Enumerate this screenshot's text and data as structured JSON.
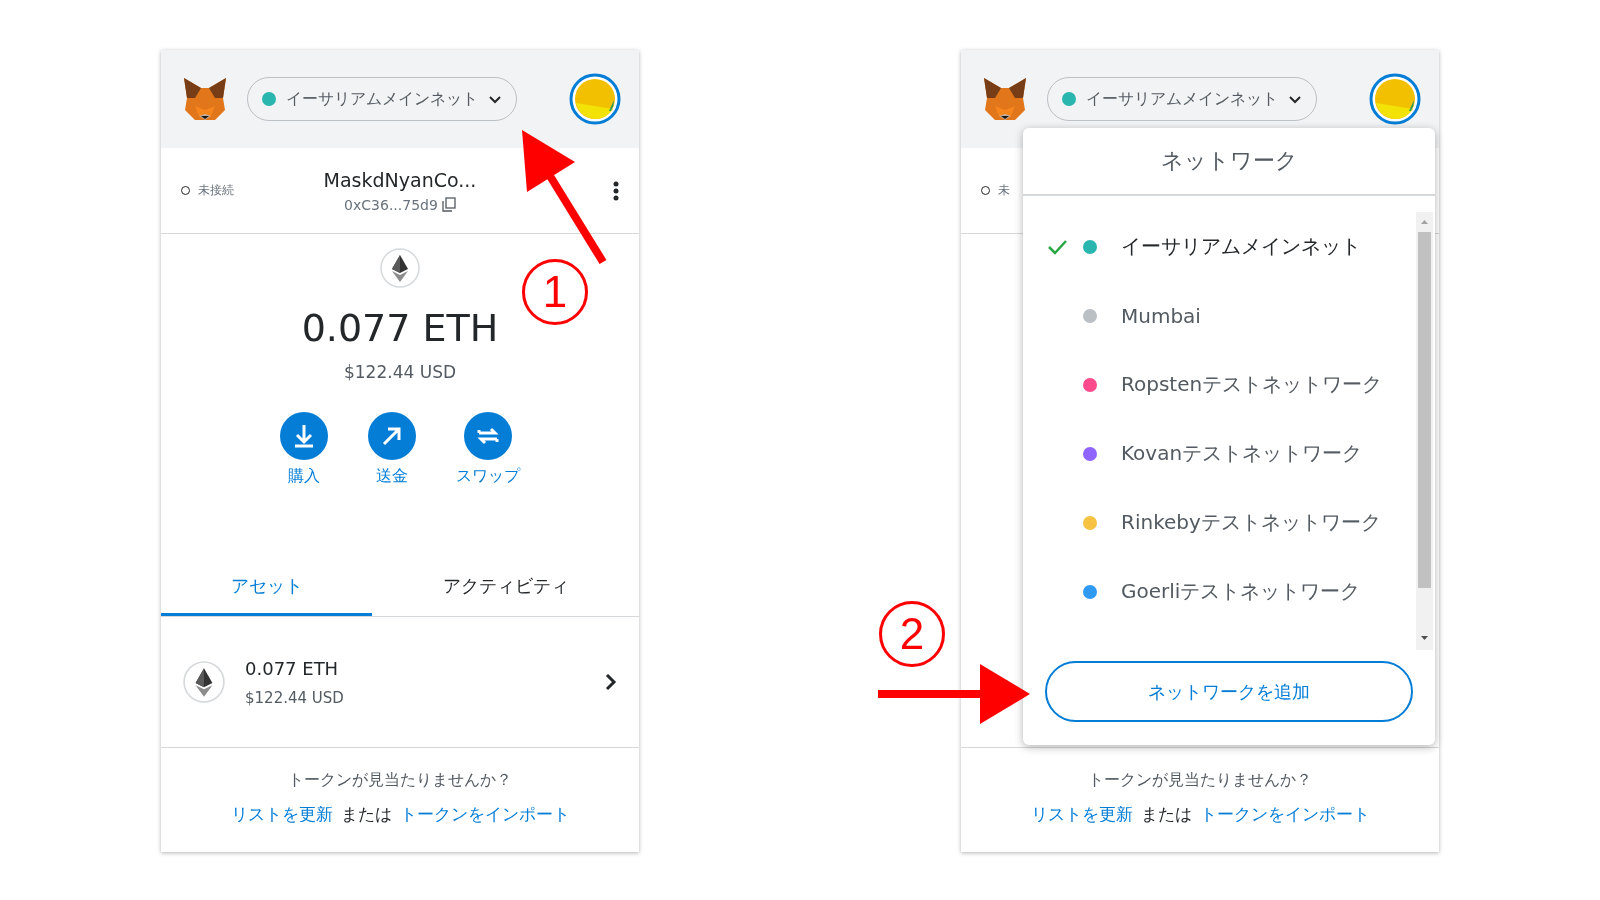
{
  "wallets": [
    {
      "header": {
        "network": {
          "label": "イーサリアムメインネット",
          "color": "#29b6af"
        }
      },
      "account": {
        "status": "未接続",
        "name": "MaskdNyanCo...",
        "address": "0xC36...75d9"
      },
      "balance": {
        "amount": "0.077 ETH",
        "fiat": "$122.44 USD"
      },
      "actions": [
        {
          "kind": "buy",
          "label": "購入"
        },
        {
          "kind": "send",
          "label": "送金"
        },
        {
          "kind": "swap",
          "label": "スワップ"
        }
      ],
      "tabs": [
        {
          "label": "アセット",
          "selected": true
        },
        {
          "label": "アクティビティ",
          "selected": false
        }
      ],
      "assets": [
        {
          "amount": "0.077 ETH",
          "fiat": "$122.44 USD"
        }
      ],
      "help": {
        "question": "トークンが見当たりませんか？",
        "refresh_link": "リストを更新",
        "conjunction": "または",
        "import_link": "トークンをインポート"
      }
    },
    {
      "header": {
        "network": {
          "label": "イーサリアムメインネット",
          "color": "#29b6af"
        }
      },
      "account": {
        "status": "未"
      },
      "help": {
        "question": "トークンが見当たりませんか？",
        "refresh_link": "リストを更新",
        "conjunction": "または",
        "import_link": "トークンをインポート"
      },
      "network_menu": {
        "title": "ネットワーク",
        "networks": [
          {
            "label": "イーサリアムメインネット",
            "color": "#29b6af",
            "selected": true
          },
          {
            "label": "Mumbai",
            "color": "#bbc0c5",
            "selected": false
          },
          {
            "label": "Ropstenテストネットワーク",
            "color": "#ff4a8d",
            "selected": false
          },
          {
            "label": "Kovanテストネットワーク",
            "color": "#9064ff",
            "selected": false
          },
          {
            "label": "Rinkebyテストネットワーク",
            "color": "#f6c343",
            "selected": false
          },
          {
            "label": "Goerliテストネットワーク",
            "color": "#3099f2",
            "selected": false
          }
        ],
        "add_button": "ネットワークを追加"
      }
    }
  ],
  "annotations": [
    {
      "label": "1"
    },
    {
      "label": "2"
    }
  ]
}
